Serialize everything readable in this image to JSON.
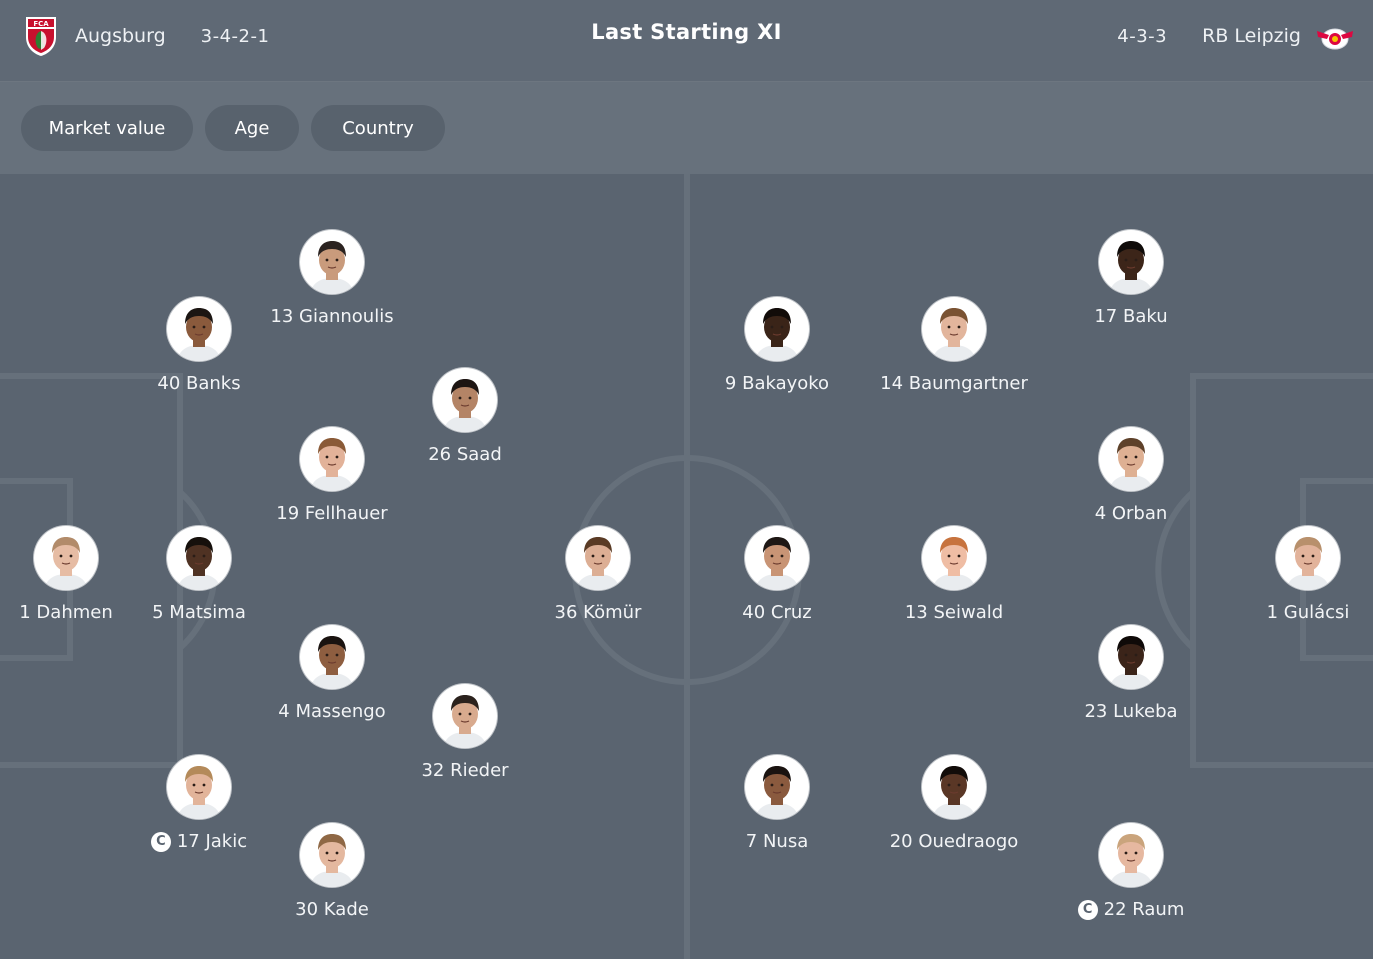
{
  "header": {
    "title": "Last Starting XI",
    "home": {
      "name": "Augsburg",
      "formation": "3-4-2-1",
      "crest_text": "FCA"
    },
    "away": {
      "name": "RB Leipzig",
      "formation": "4-3-3"
    }
  },
  "filters": [
    "Market value",
    "Age",
    "Country"
  ],
  "colors": {
    "background": "#5c6672",
    "header": "#5f6975",
    "filter_bar": "#67717c",
    "chip": "#58626d",
    "pitch": "#5a6470",
    "pitch_lines": "#66707b"
  },
  "players": [
    {
      "team": "home",
      "label": "13 Giannoulis",
      "captain": false,
      "skin": "#c99b7c",
      "hair": "#2b2320"
    },
    {
      "team": "home",
      "label": "40 Banks",
      "captain": false,
      "skin": "#8a5a3c",
      "hair": "#1c1613"
    },
    {
      "team": "home",
      "label": "26 Saad",
      "captain": false,
      "skin": "#b48466",
      "hair": "#1d1512"
    },
    {
      "team": "home",
      "label": "19 Fellhauer",
      "captain": false,
      "skin": "#e2b299",
      "hair": "#8a5a37"
    },
    {
      "team": "home",
      "label": "1 Dahmen",
      "captain": false,
      "skin": "#e6bca4",
      "hair": "#b28b6a"
    },
    {
      "team": "home",
      "label": "5 Matsima",
      "captain": false,
      "skin": "#4f3223",
      "hair": "#16100c"
    },
    {
      "team": "home",
      "label": "36 Kömür",
      "captain": false,
      "skin": "#dcae94",
      "hair": "#5a3b25"
    },
    {
      "team": "home",
      "label": "4 Massengo",
      "captain": false,
      "skin": "#8e5e40",
      "hair": "#1a1310"
    },
    {
      "team": "home",
      "label": "32 Rieder",
      "captain": false,
      "skin": "#d8aa8e",
      "hair": "#2b221d"
    },
    {
      "team": "home",
      "label": "17 Jakic",
      "captain": true,
      "skin": "#e2b49a",
      "hair": "#b48a5a"
    },
    {
      "team": "home",
      "label": "30 Kade",
      "captain": false,
      "skin": "#e4b89f",
      "hair": "#8f6845"
    },
    {
      "team": "away",
      "label": "17 Baku",
      "captain": false,
      "skin": "#3c2519",
      "hair": "#0f0b09"
    },
    {
      "team": "away",
      "label": "9 Bakayoko",
      "captain": false,
      "skin": "#3a2418",
      "hair": "#120c09"
    },
    {
      "team": "away",
      "label": "14 Baumgartner",
      "captain": false,
      "skin": "#e2b59c",
      "hair": "#7a5232"
    },
    {
      "team": "away",
      "label": "4 Orban",
      "captain": false,
      "skin": "#deb093",
      "hair": "#5e412a"
    },
    {
      "team": "away",
      "label": "40 Cruz",
      "captain": false,
      "skin": "#c89475",
      "hair": "#1e1714"
    },
    {
      "team": "away",
      "label": "13 Seiwald",
      "captain": false,
      "skin": "#efbda4",
      "hair": "#c7733e"
    },
    {
      "team": "away",
      "label": "1 Gulácsi",
      "captain": false,
      "skin": "#e2b39b",
      "hair": "#b8906c"
    },
    {
      "team": "away",
      "label": "23 Lukeba",
      "captain": false,
      "skin": "#3b2419",
      "hair": "#0f0a08"
    },
    {
      "team": "away",
      "label": "7 Nusa",
      "captain": false,
      "skin": "#8a5a3e",
      "hair": "#1a1310"
    },
    {
      "team": "away",
      "label": "20 Ouedraogo",
      "captain": false,
      "skin": "#5a3726",
      "hair": "#120c09"
    },
    {
      "team": "away",
      "label": "22 Raum",
      "captain": true,
      "skin": "#e6b8a0",
      "hair": "#caa47c"
    }
  ]
}
